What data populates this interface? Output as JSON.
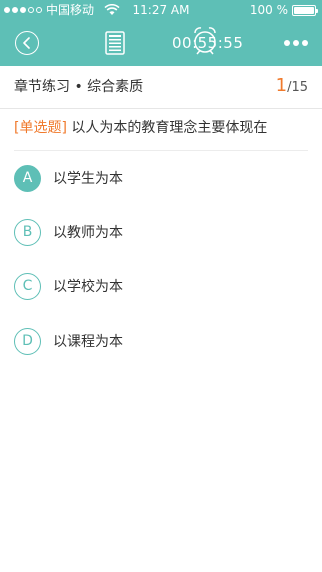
{
  "status_bar": {
    "carrier": "中国移动",
    "time": "11:27 AM",
    "battery": "100 %"
  },
  "nav": {
    "timer": "00:55:55",
    "icons": {
      "back": "back-circle-icon",
      "answer_card": "answer-card-icon",
      "clock": "alarm-clock-icon",
      "more": "more-dots-icon"
    }
  },
  "section": {
    "title": "章节练习 • 综合素质",
    "current": "1",
    "total": "/15"
  },
  "question": {
    "type": "[单选题]",
    "text": " 以人为本的教育理念主要体现在"
  },
  "options": [
    {
      "letter": "A",
      "text": "以学生为本",
      "selected": true
    },
    {
      "letter": "B",
      "text": "以教师为本",
      "selected": false
    },
    {
      "letter": "C",
      "text": "以学校为本",
      "selected": false
    },
    {
      "letter": "D",
      "text": "以课程为本",
      "selected": false
    }
  ],
  "colors": {
    "accent": "#5ebfb6",
    "highlight": "#f07a2c"
  }
}
